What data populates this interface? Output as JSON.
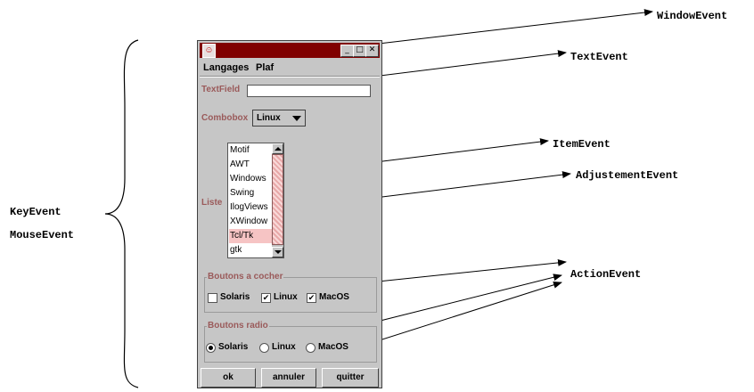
{
  "annotations": {
    "keys_left": [
      "KeyEvent",
      "MouseEvent"
    ],
    "events": [
      "WindowEvent",
      "TextEvent",
      "ItemEvent",
      "AdjustementEvent",
      "ActionEvent"
    ]
  },
  "window": {
    "menu": [
      "Langages",
      "Plaf"
    ],
    "textfield": {
      "label": "TextField",
      "value": ""
    },
    "combobox": {
      "label": "Combobox",
      "selected": "Linux"
    },
    "list": {
      "label": "Liste",
      "items": [
        "Motif",
        "AWT",
        "Windows",
        "Swing",
        "IlogViews",
        "XWindow",
        "Tcl/Tk",
        "gtk"
      ],
      "selected": "Tcl/Tk"
    },
    "checkboxes": {
      "title": "Boutons a cocher",
      "options": [
        {
          "label": "Solaris",
          "checked": false
        },
        {
          "label": "Linux",
          "checked": true
        },
        {
          "label": "MacOS",
          "checked": true
        }
      ]
    },
    "radios": {
      "title": "Boutons radio",
      "options": [
        {
          "label": "Solaris",
          "selected": true
        },
        {
          "label": "Linux",
          "selected": false
        },
        {
          "label": "MacOS",
          "selected": false
        }
      ]
    },
    "buttons": [
      "ok",
      "annuler",
      "quitter"
    ]
  }
}
